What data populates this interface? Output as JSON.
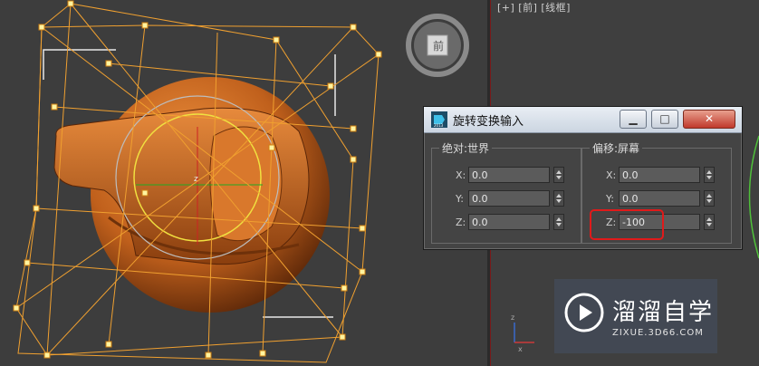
{
  "viewport_right": {
    "label": "[+] [前] [线框]"
  },
  "dialog": {
    "title": "旋转变换输入",
    "buttons": {
      "minimize": "▁",
      "maximize": "□",
      "close": "✕"
    },
    "absolute": {
      "legend": "绝对:世界",
      "x_label": "X:",
      "x_value": "0.0",
      "y_label": "Y:",
      "y_value": "0.0",
      "z_label": "Z:",
      "z_value": "0.0"
    },
    "offset": {
      "legend": "偏移:屏幕",
      "x_label": "X:",
      "x_value": "0.0",
      "y_label": "Y:",
      "y_value": "0.0",
      "z_label": "Z:",
      "z_value": "-100"
    }
  },
  "watermark": {
    "text": "溜溜自学",
    "url": "ZIXUE.3D66.COM"
  },
  "colors": {
    "highlight": "#e01a1a",
    "model": "#c8651e",
    "cage": "#f0a030",
    "viewport": "#3d3d3d"
  }
}
